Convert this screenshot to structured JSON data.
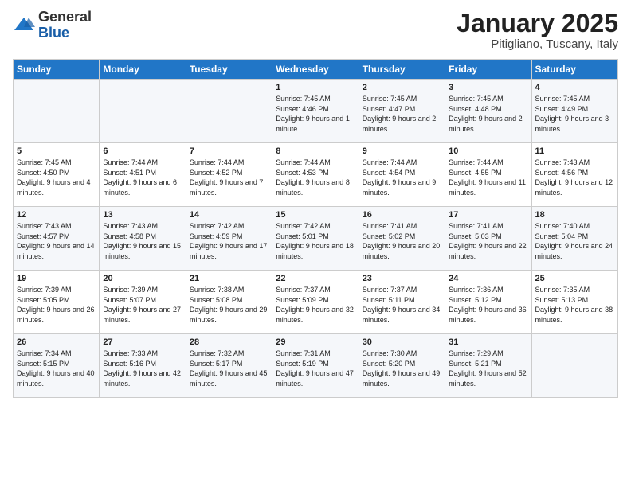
{
  "logo": {
    "general": "General",
    "blue": "Blue"
  },
  "header": {
    "title": "January 2025",
    "subtitle": "Pitigliano, Tuscany, Italy"
  },
  "weekdays": [
    "Sunday",
    "Monday",
    "Tuesday",
    "Wednesday",
    "Thursday",
    "Friday",
    "Saturday"
  ],
  "weeks": [
    [
      {
        "day": "",
        "info": ""
      },
      {
        "day": "",
        "info": ""
      },
      {
        "day": "",
        "info": ""
      },
      {
        "day": "1",
        "info": "Sunrise: 7:45 AM\nSunset: 4:46 PM\nDaylight: 9 hours\nand 1 minute."
      },
      {
        "day": "2",
        "info": "Sunrise: 7:45 AM\nSunset: 4:47 PM\nDaylight: 9 hours\nand 2 minutes."
      },
      {
        "day": "3",
        "info": "Sunrise: 7:45 AM\nSunset: 4:48 PM\nDaylight: 9 hours\nand 2 minutes."
      },
      {
        "day": "4",
        "info": "Sunrise: 7:45 AM\nSunset: 4:49 PM\nDaylight: 9 hours\nand 3 minutes."
      }
    ],
    [
      {
        "day": "5",
        "info": "Sunrise: 7:45 AM\nSunset: 4:50 PM\nDaylight: 9 hours\nand 4 minutes."
      },
      {
        "day": "6",
        "info": "Sunrise: 7:44 AM\nSunset: 4:51 PM\nDaylight: 9 hours\nand 6 minutes."
      },
      {
        "day": "7",
        "info": "Sunrise: 7:44 AM\nSunset: 4:52 PM\nDaylight: 9 hours\nand 7 minutes."
      },
      {
        "day": "8",
        "info": "Sunrise: 7:44 AM\nSunset: 4:53 PM\nDaylight: 9 hours\nand 8 minutes."
      },
      {
        "day": "9",
        "info": "Sunrise: 7:44 AM\nSunset: 4:54 PM\nDaylight: 9 hours\nand 9 minutes."
      },
      {
        "day": "10",
        "info": "Sunrise: 7:44 AM\nSunset: 4:55 PM\nDaylight: 9 hours\nand 11 minutes."
      },
      {
        "day": "11",
        "info": "Sunrise: 7:43 AM\nSunset: 4:56 PM\nDaylight: 9 hours\nand 12 minutes."
      }
    ],
    [
      {
        "day": "12",
        "info": "Sunrise: 7:43 AM\nSunset: 4:57 PM\nDaylight: 9 hours\nand 14 minutes."
      },
      {
        "day": "13",
        "info": "Sunrise: 7:43 AM\nSunset: 4:58 PM\nDaylight: 9 hours\nand 15 minutes."
      },
      {
        "day": "14",
        "info": "Sunrise: 7:42 AM\nSunset: 4:59 PM\nDaylight: 9 hours\nand 17 minutes."
      },
      {
        "day": "15",
        "info": "Sunrise: 7:42 AM\nSunset: 5:01 PM\nDaylight: 9 hours\nand 18 minutes."
      },
      {
        "day": "16",
        "info": "Sunrise: 7:41 AM\nSunset: 5:02 PM\nDaylight: 9 hours\nand 20 minutes."
      },
      {
        "day": "17",
        "info": "Sunrise: 7:41 AM\nSunset: 5:03 PM\nDaylight: 9 hours\nand 22 minutes."
      },
      {
        "day": "18",
        "info": "Sunrise: 7:40 AM\nSunset: 5:04 PM\nDaylight: 9 hours\nand 24 minutes."
      }
    ],
    [
      {
        "day": "19",
        "info": "Sunrise: 7:39 AM\nSunset: 5:05 PM\nDaylight: 9 hours\nand 26 minutes."
      },
      {
        "day": "20",
        "info": "Sunrise: 7:39 AM\nSunset: 5:07 PM\nDaylight: 9 hours\nand 27 minutes."
      },
      {
        "day": "21",
        "info": "Sunrise: 7:38 AM\nSunset: 5:08 PM\nDaylight: 9 hours\nand 29 minutes."
      },
      {
        "day": "22",
        "info": "Sunrise: 7:37 AM\nSunset: 5:09 PM\nDaylight: 9 hours\nand 32 minutes."
      },
      {
        "day": "23",
        "info": "Sunrise: 7:37 AM\nSunset: 5:11 PM\nDaylight: 9 hours\nand 34 minutes."
      },
      {
        "day": "24",
        "info": "Sunrise: 7:36 AM\nSunset: 5:12 PM\nDaylight: 9 hours\nand 36 minutes."
      },
      {
        "day": "25",
        "info": "Sunrise: 7:35 AM\nSunset: 5:13 PM\nDaylight: 9 hours\nand 38 minutes."
      }
    ],
    [
      {
        "day": "26",
        "info": "Sunrise: 7:34 AM\nSunset: 5:15 PM\nDaylight: 9 hours\nand 40 minutes."
      },
      {
        "day": "27",
        "info": "Sunrise: 7:33 AM\nSunset: 5:16 PM\nDaylight: 9 hours\nand 42 minutes."
      },
      {
        "day": "28",
        "info": "Sunrise: 7:32 AM\nSunset: 5:17 PM\nDaylight: 9 hours\nand 45 minutes."
      },
      {
        "day": "29",
        "info": "Sunrise: 7:31 AM\nSunset: 5:19 PM\nDaylight: 9 hours\nand 47 minutes."
      },
      {
        "day": "30",
        "info": "Sunrise: 7:30 AM\nSunset: 5:20 PM\nDaylight: 9 hours\nand 49 minutes."
      },
      {
        "day": "31",
        "info": "Sunrise: 7:29 AM\nSunset: 5:21 PM\nDaylight: 9 hours\nand 52 minutes."
      },
      {
        "day": "",
        "info": ""
      }
    ]
  ]
}
